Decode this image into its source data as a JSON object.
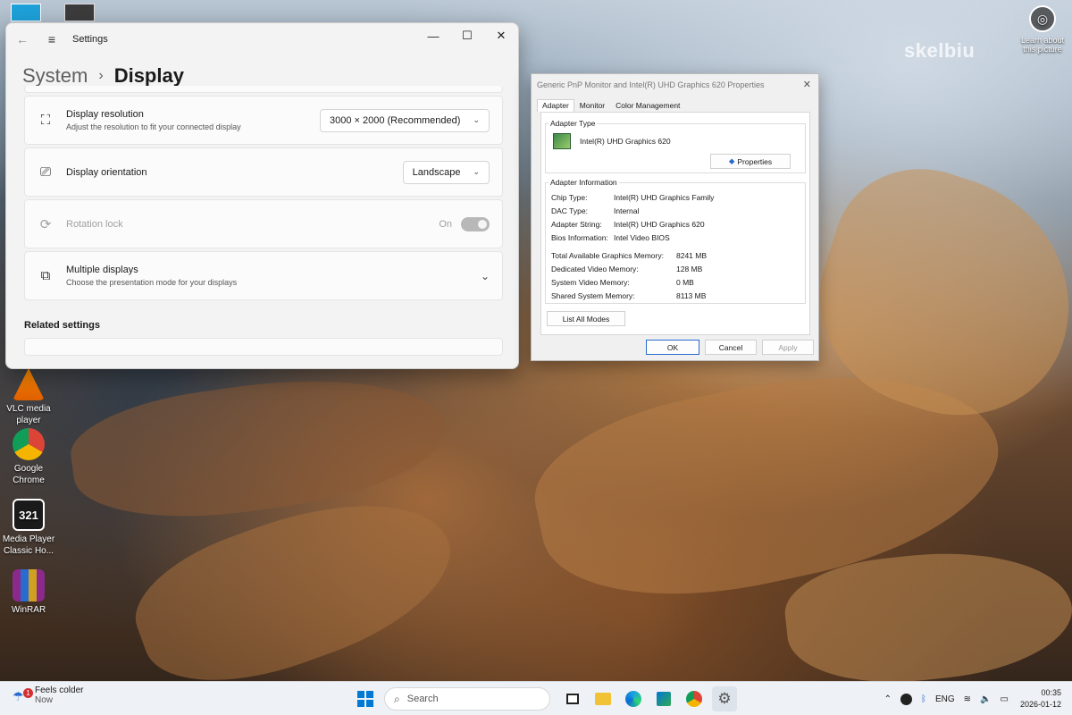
{
  "desktop": {
    "icons": [
      {
        "label": "VLC media player"
      },
      {
        "label": "Google Chrome"
      },
      {
        "label": "Media Player Classic Ho..."
      },
      {
        "label": "WinRAR"
      }
    ],
    "learn_label": "Learn about this picture",
    "watermark": "skelbiu"
  },
  "settings": {
    "window_title": "Settings",
    "breadcrumb_parent": "System",
    "breadcrumb_current": "Display",
    "rows": {
      "resolution": {
        "title": "Display resolution",
        "subtitle": "Adjust the resolution to fit your connected display",
        "value": "3000 × 2000 (Recommended)"
      },
      "orientation": {
        "title": "Display orientation",
        "value": "Landscape"
      },
      "rotation": {
        "title": "Rotation lock",
        "state": "On"
      },
      "multiple": {
        "title": "Multiple displays",
        "subtitle": "Choose the presentation mode for your displays"
      }
    },
    "related_heading": "Related settings"
  },
  "props_dialog": {
    "title": "Generic PnP Monitor and Intel(R) UHD Graphics 620 Properties",
    "tabs": [
      "Adapter",
      "Monitor",
      "Color Management"
    ],
    "adapter_type_label": "Adapter Type",
    "adapter_name": "Intel(R) UHD Graphics 620",
    "properties_button": "Properties",
    "adapter_info_label": "Adapter Information",
    "info": [
      {
        "k": "Chip Type:",
        "v": "Intel(R) UHD Graphics Family"
      },
      {
        "k": "DAC Type:",
        "v": "Internal"
      },
      {
        "k": "Adapter String:",
        "v": "Intel(R) UHD Graphics 620"
      },
      {
        "k": "Bios Information:",
        "v": "Intel Video BIOS"
      }
    ],
    "memory": [
      {
        "k": "Total Available Graphics Memory:",
        "v": "8241 MB"
      },
      {
        "k": "Dedicated Video Memory:",
        "v": "128 MB"
      },
      {
        "k": "System Video Memory:",
        "v": "0 MB"
      },
      {
        "k": "Shared System Memory:",
        "v": "8113 MB"
      }
    ],
    "list_modes_button": "List All Modes",
    "ok": "OK",
    "cancel": "Cancel",
    "apply": "Apply"
  },
  "taskbar": {
    "weather_title": "Feels colder",
    "weather_sub": "Now",
    "weather_badge": "1",
    "search_placeholder": "Search",
    "language": "ENG",
    "time": "00:35",
    "date": "2026-01-12"
  },
  "colors": {
    "accent": "#0067c0",
    "chrome_red": "#db4437"
  }
}
